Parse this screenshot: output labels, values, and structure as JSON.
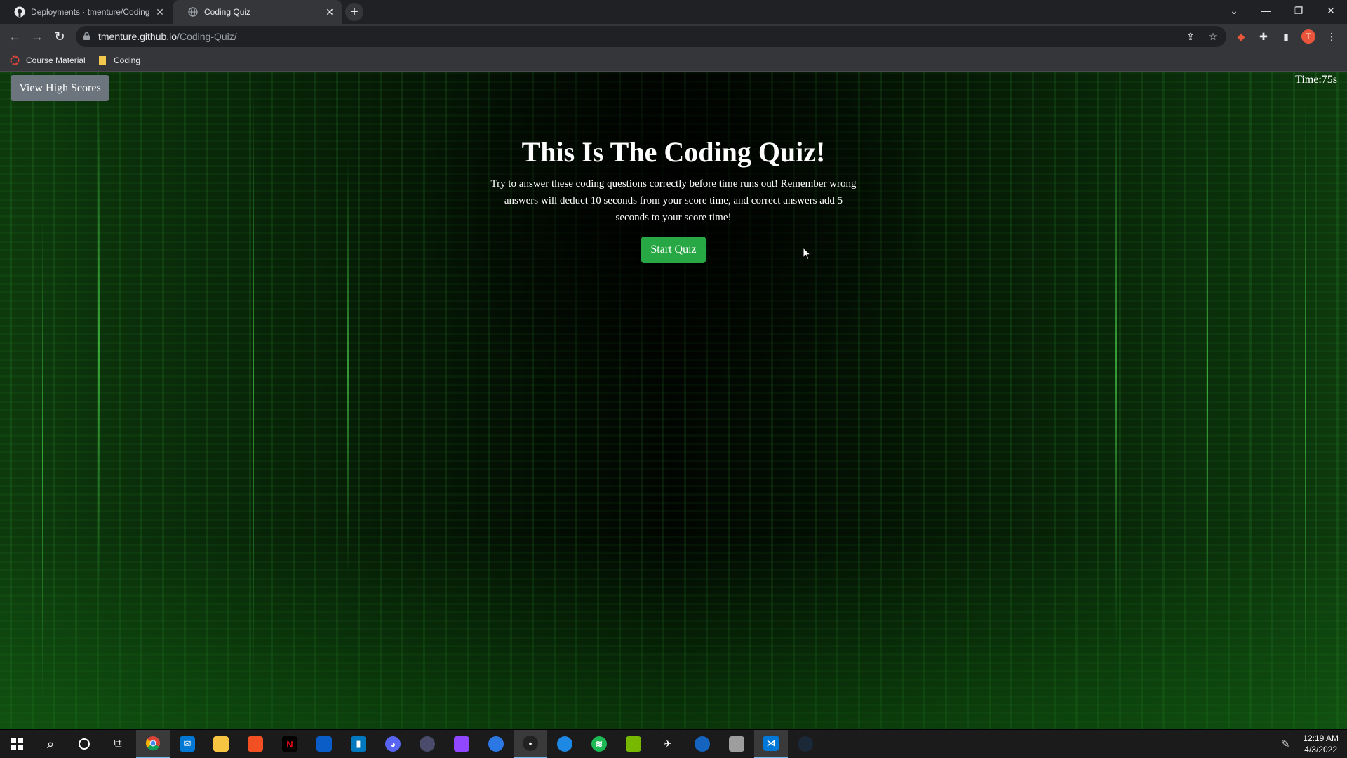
{
  "browser": {
    "tabs": [
      {
        "title": "Deployments · tmenture/Coding",
        "icon": "github-icon",
        "active": false
      },
      {
        "title": "Coding Quiz",
        "icon": "globe-icon",
        "active": true
      }
    ],
    "url_host": "tmenture.github.io",
    "url_path": "/Coding-Quiz/",
    "avatar_letter": "T",
    "bookmarks": [
      {
        "label": "Course Material",
        "icon": "course-icon"
      },
      {
        "label": "Coding",
        "icon": "folder-icon"
      }
    ]
  },
  "page": {
    "high_scores_label": "View High Scores",
    "timer": "Time:75s",
    "title": "This Is The Coding Quiz!",
    "description": "Try to answer these coding questions correctly before time runs out! Remember wrong answers will deduct 10 seconds from your score time, and correct answers add 5 seconds to your score time!",
    "start_label": "Start Quiz"
  },
  "taskbar": {
    "apps": [
      "start-icon",
      "search-icon",
      "cortana-icon",
      "task-view-icon",
      "chrome-icon",
      "mail-icon",
      "file-explorer-icon",
      "store-icon",
      "netflix-icon",
      "app-icon",
      "trello-icon",
      "discord-icon",
      "app-icon",
      "twitch-icon",
      "app-icon",
      "app-icon",
      "app-icon",
      "spotify-icon",
      "nvidia-icon",
      "app-icon",
      "app-icon",
      "app-icon",
      "vscode-icon",
      "steam-icon"
    ],
    "time": "12:19 AM",
    "date": "4/3/2022"
  },
  "colors": {
    "high_scores_button": "#6c757d",
    "start_button": "#28a745",
    "matrix_green": "#1fae3a"
  }
}
